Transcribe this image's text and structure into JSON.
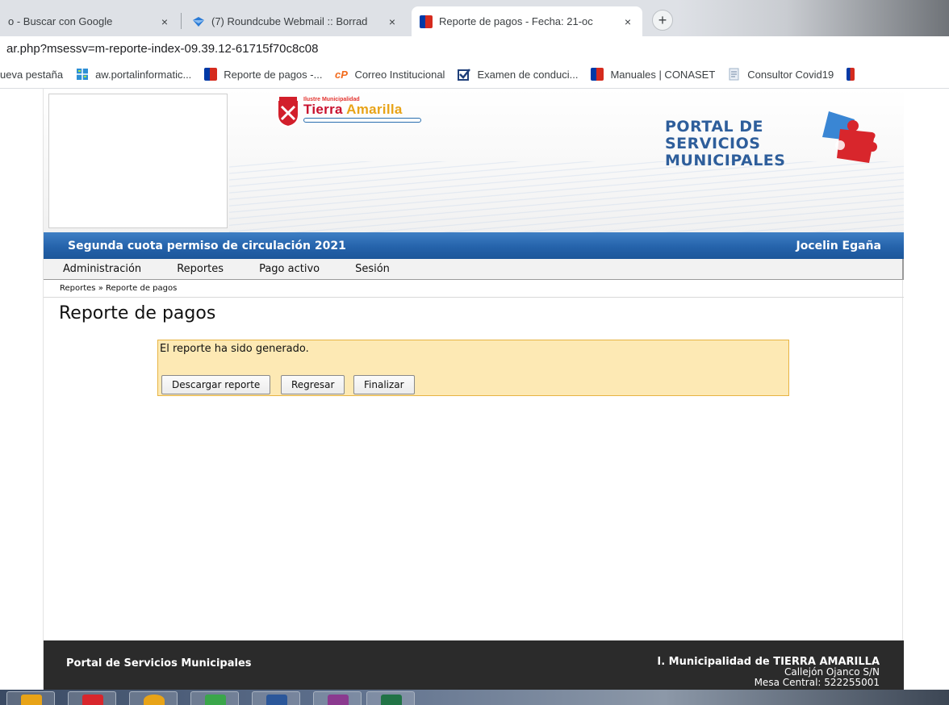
{
  "browser": {
    "tabs": [
      {
        "label": "o - Buscar con Google",
        "close": "×"
      },
      {
        "label": "(7) Roundcube Webmail :: Borrad",
        "close": "×"
      },
      {
        "label": "Reporte de pagos - Fecha: 21-oc",
        "close": "×"
      }
    ],
    "new_tab": "+",
    "url": "ar.php?msessv=m-reporte-index-09.39.12-61715f70c8c08",
    "bookmarks": [
      {
        "label": "ueva pestaña",
        "icon": "none"
      },
      {
        "label": "aw.portalinformatic...",
        "icon": "grid-icon"
      },
      {
        "label": "Reporte de pagos -...",
        "icon": "flag-icon"
      },
      {
        "label": "Correo Institucional",
        "icon": "cp-icon"
      },
      {
        "label": "Examen de conduci...",
        "icon": "check-icon"
      },
      {
        "label": "Manuales | CONASET",
        "icon": "flag-icon"
      },
      {
        "label": "Consultor Covid19",
        "icon": "doc-icon"
      }
    ]
  },
  "header": {
    "muni_small": "Ilustre Municipalidad",
    "muni_name_1": "Tierra ",
    "muni_name_2": "Amarilla",
    "portal_title_1": "PORTAL DE",
    "portal_title_2": "SERVICIOS",
    "portal_title_3": "MUNICIPALES"
  },
  "bluebar": {
    "title": "Segunda cuota permiso de circulación 2021",
    "user": "Jocelin Egaña"
  },
  "menu": [
    "Administración",
    "Reportes",
    "Pago activo",
    "Sesión"
  ],
  "breadcrumb": "Reportes » Reporte de pagos",
  "page_title": "Reporte de pagos",
  "notice": {
    "message": "El reporte ha sido generado.",
    "buttons": {
      "download": "Descargar reporte",
      "back": "Regresar",
      "finish": "Finalizar"
    }
  },
  "footer": {
    "left": "Portal de Servicios Municipales",
    "right_1": "I. Municipalidad de TIERRA AMARILLA",
    "right_2": "Callejón Ojanco S/N",
    "right_3": "Mesa Central: 522255001"
  },
  "colors": {
    "accent_blue": "#2563ab",
    "notice_bg": "#fde9b4",
    "notice_border": "#e7b443",
    "footer_bg": "#2b2b2b"
  }
}
